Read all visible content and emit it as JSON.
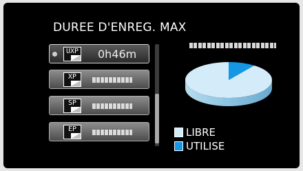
{
  "screen": {
    "title": "DUREE D'ENREG. MAX"
  },
  "modes": [
    {
      "code": "UXP",
      "time": "0h46m",
      "selected": true
    },
    {
      "code": "XP",
      "time": "",
      "selected": false
    },
    {
      "code": "SP",
      "time": "",
      "selected": false
    },
    {
      "code": "EP",
      "time": "",
      "selected": false
    }
  ],
  "usage_chart": {
    "type": "pie",
    "slices": [
      {
        "label": "LIBRE",
        "value": 90,
        "color": "#d4ecfa"
      },
      {
        "label": "UTILISE",
        "value": 10,
        "color": "#1597e5"
      }
    ]
  },
  "legend": {
    "free_label": "LIBRE",
    "used_label": "UTILISE",
    "free_color": "#d4ecfa",
    "used_color": "#1597e5"
  }
}
